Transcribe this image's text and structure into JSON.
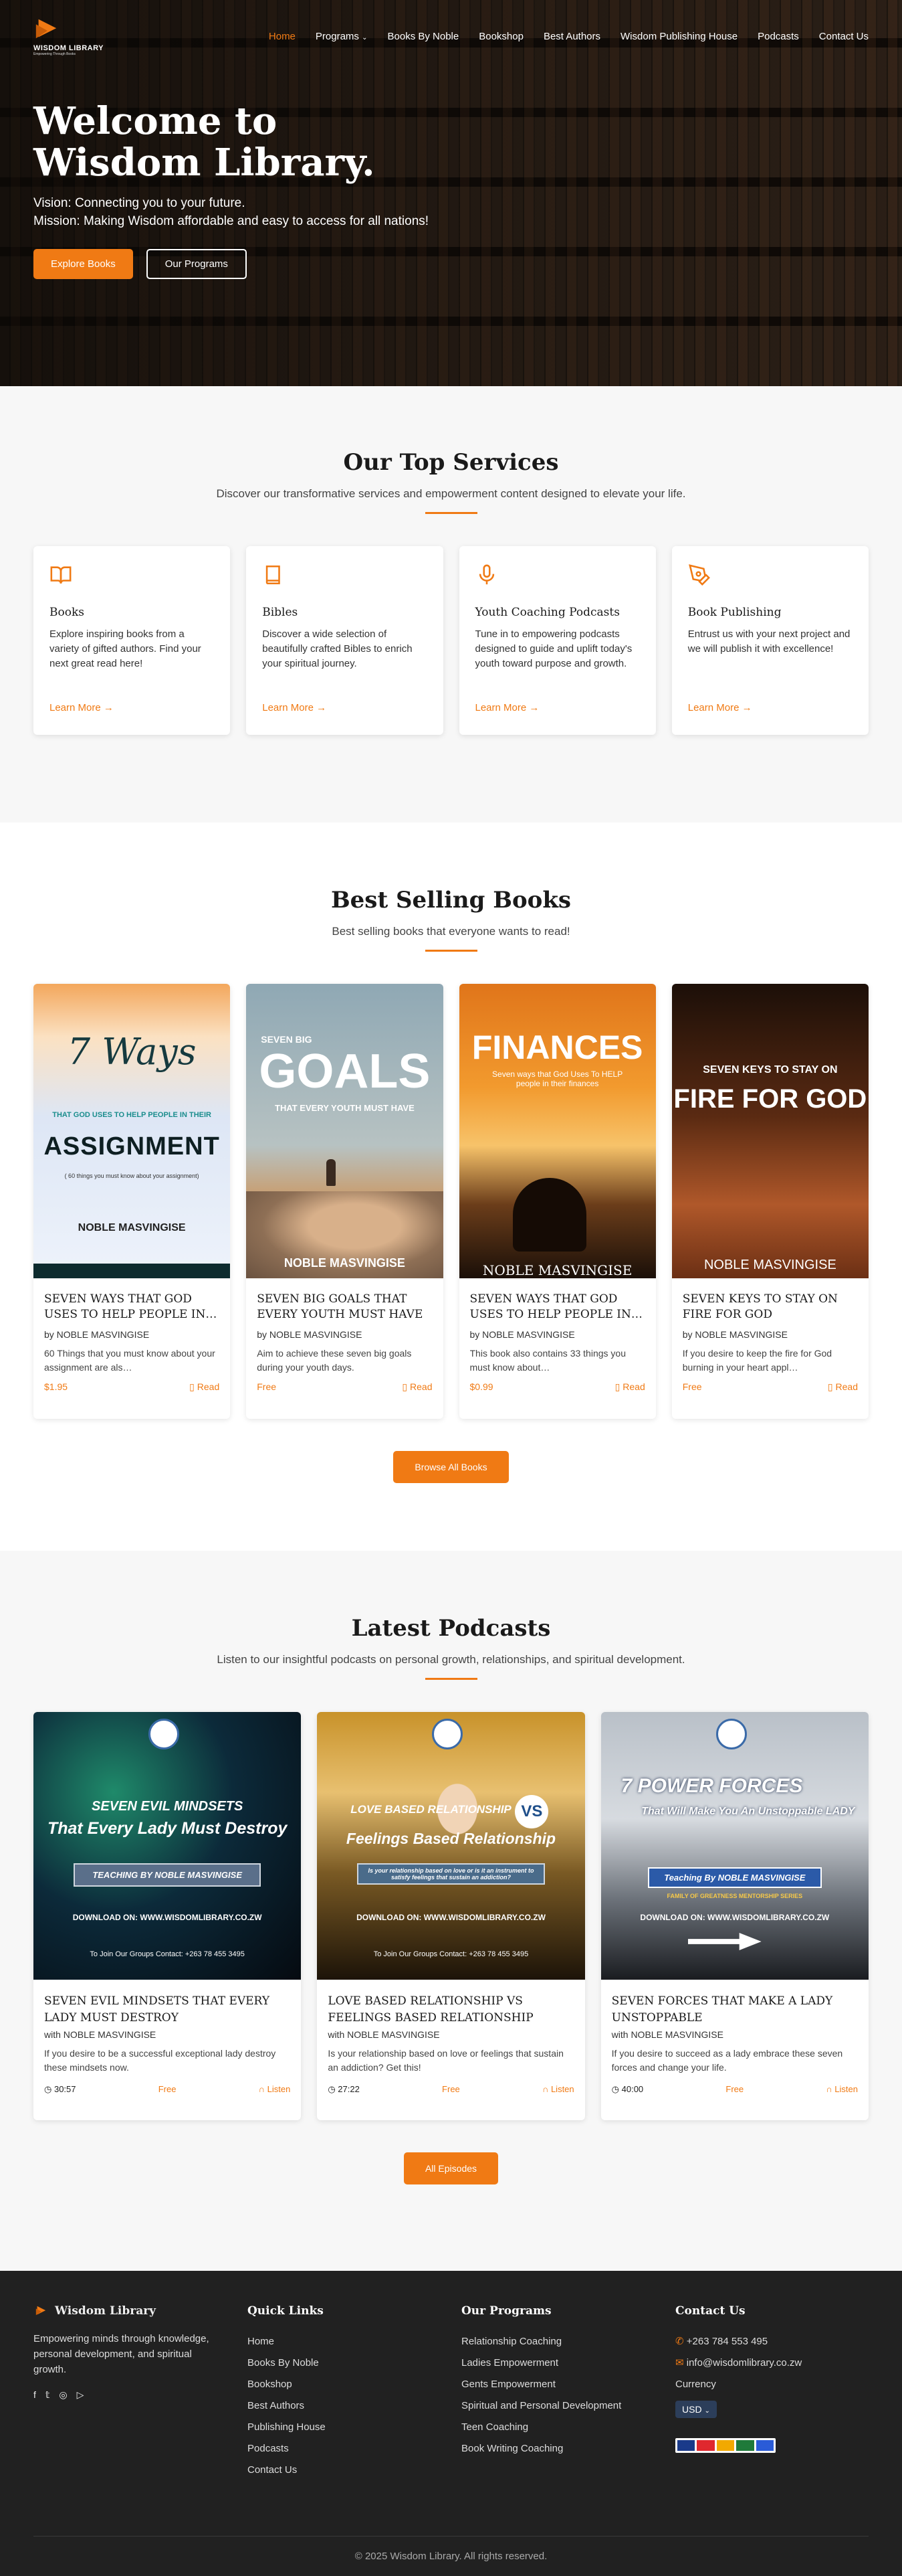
{
  "nav": {
    "logo": "WISDOM LIBRARY",
    "logo_tag": "Empowering Through Books",
    "items": [
      "Home",
      "Programs",
      "Books By Noble",
      "Bookshop",
      "Best Authors",
      "Wisdom Publishing House",
      "Podcasts",
      "Contact Us"
    ]
  },
  "hero": {
    "title": "Welcome to Wisdom Library.",
    "vision": "Vision: Connecting you to your future.",
    "mission": "Mission: Making Wisdom affordable and easy to access for all nations!",
    "btn1": "Explore Books",
    "btn2": "Our Programs"
  },
  "services": {
    "title": "Our Top Services",
    "subtitle": "Discover our transformative services and empowerment content designed to elevate your life.",
    "items": [
      {
        "icon": "book-open-icon",
        "title": "Books",
        "desc": "Explore inspiring books from a variety of gifted authors. Find your next great read here!",
        "link": "Learn More →"
      },
      {
        "icon": "bible-icon",
        "title": "Bibles",
        "desc": "Discover a wide selection of beautifully crafted Bibles to enrich your spiritual journey.",
        "link": "Learn More →"
      },
      {
        "icon": "microphone-icon",
        "title": "Youth Coaching Podcasts",
        "desc": "Tune in to empowering podcasts designed to guide and uplift today's youth toward purpose and growth.",
        "link": "Learn More →"
      },
      {
        "icon": "pen-tool-icon",
        "title": "Book Publishing",
        "desc": "Entrust us with your next project and we will publish it with excellence!",
        "link": "Learn More →"
      }
    ]
  },
  "books": {
    "title": "Best Selling Books",
    "subtitle": "Best selling books that everyone wants to read!",
    "read_label": "Read",
    "browse": "Browse All Books",
    "items": [
      {
        "title": "SEVEN WAYS THAT GOD USES TO HELP PEOPLE IN…",
        "author": "by NOBLE MASVINGISE",
        "desc": "60 Things that you must know about your assignment are als…",
        "price": "$1.95"
      },
      {
        "title": "SEVEN BIG GOALS THAT EVERY YOUTH MUST HAVE",
        "author": "by NOBLE MASVINGISE",
        "desc": "Aim to achieve these seven big goals during your youth days.",
        "price": "Free"
      },
      {
        "title": "SEVEN WAYS THAT GOD USES TO HELP PEOPLE IN…",
        "author": "by NOBLE MASVINGISE",
        "desc": "This book also contains 33 things you must know about…",
        "price": "$0.99"
      },
      {
        "title": "SEVEN KEYS TO STAY ON FIRE FOR GOD",
        "author": "by NOBLE MASVINGISE",
        "desc": "If you desire to keep the fire for God burning in your heart appl…",
        "price": "Free"
      }
    ],
    "covers": [
      {
        "l1": "7 Ways",
        "l2": "THAT GOD USES TO HELP PEOPLE IN THEIR",
        "l3": "ASSIGNMENT",
        "l4": "( 60 things you must know about your assignment)",
        "l5": "NOBLE MASVINGISE"
      },
      {
        "l1": "SEVEN BIG",
        "l2": "GOALS",
        "l3": "THAT EVERY YOUTH MUST HAVE",
        "l5": "NOBLE MASVINGISE"
      },
      {
        "l1": "FINANCES",
        "l2": "Seven ways that God Uses To HELP people in their finances",
        "l5": "NOBLE MASVINGISE"
      },
      {
        "l1": "SEVEN KEYS TO STAY ON",
        "l2": "FIRE FOR GOD",
        "l5": "NOBLE MASVINGISE"
      }
    ]
  },
  "podcasts": {
    "title": "Latest Podcasts",
    "subtitle": "Listen to our insightful podcasts on personal growth, relationships, and spiritual development.",
    "listen": "Listen",
    "all": "All Episodes",
    "items": [
      {
        "title": "SEVEN EVIL MINDSETS THAT EVERY LADY MUST DESTROY",
        "host": "with NOBLE MASVINGISE",
        "desc": "If you desire to be a successful exceptional lady destroy these mindsets now.",
        "duration": "30:57",
        "price": "Free"
      },
      {
        "title": "LOVE BASED RELATIONSHIP VS FEELINGS BASED RELATIONSHIP",
        "host": "with NOBLE MASVINGISE",
        "desc": "Is your relationship based on love or feelings that sustain an addiction? Get this!",
        "duration": "27:22",
        "price": "Free"
      },
      {
        "title": "SEVEN FORCES THAT MAKE A LADY UNSTOPPABLE",
        "host": "with NOBLE MASVINGISE",
        "desc": "If you desire to succeed as a lady embrace these seven forces and change your life.",
        "duration": "40:00",
        "price": "Free"
      }
    ],
    "covers": [
      {
        "l1": "SEVEN EVIL MINDSETS",
        "l2": "That Every Lady Must Destroy",
        "l3": "TEACHING BY NOBLE MASVINGISE",
        "l4": "DOWNLOAD ON: WWW.WISDOMLIBRARY.CO.ZW",
        "l5": "To Join Our Groups Contact: +263 78 455 3495"
      },
      {
        "l1": "LOVE BASED RELATIONSHIP",
        "l2": "Feelings Based Relationship",
        "l3": "Is your relationship based on love or is it an instrument to satisfy feelings that sustain an addiction?",
        "l4": "DOWNLOAD ON: WWW.WISDOMLIBRARY.CO.ZW",
        "l5": "To Join Our Groups Contact: +263 78 455 3495",
        "vs": "VS"
      },
      {
        "l1": "7 POWER FORCES",
        "l2": "That Will Make You An Unstoppable LADY",
        "l3": "Teaching By NOBLE MASVINGISE",
        "l4": "DOWNLOAD ON: WWW.WISDOMLIBRARY.CO.ZW",
        "l5": "FAMILY OF GREATNESS MENTORSHIP SERIES"
      }
    ]
  },
  "footer": {
    "brand": "Wisdom Library",
    "about": "Empowering minds through knowledge, personal development, and spiritual growth.",
    "quick_title": "Quick Links",
    "quick": [
      "Home",
      "Books By Noble",
      "Bookshop",
      "Best Authors",
      "Publishing House",
      "Podcasts",
      "Contact Us"
    ],
    "prog_title": "Our Programs",
    "programs": [
      "Relationship Coaching",
      "Ladies Empowerment",
      "Gents Empowerment",
      "Spiritual and Personal Development",
      "Teen Coaching",
      "Book Writing Coaching"
    ],
    "contact_title": "Contact Us",
    "phone": "+263 784 553 495",
    "email": "info@wisdomlibrary.co.zw",
    "currency_label": "Currency",
    "currency": "USD",
    "copyright": "© 2025 Wisdom Library. All rights reserved."
  }
}
